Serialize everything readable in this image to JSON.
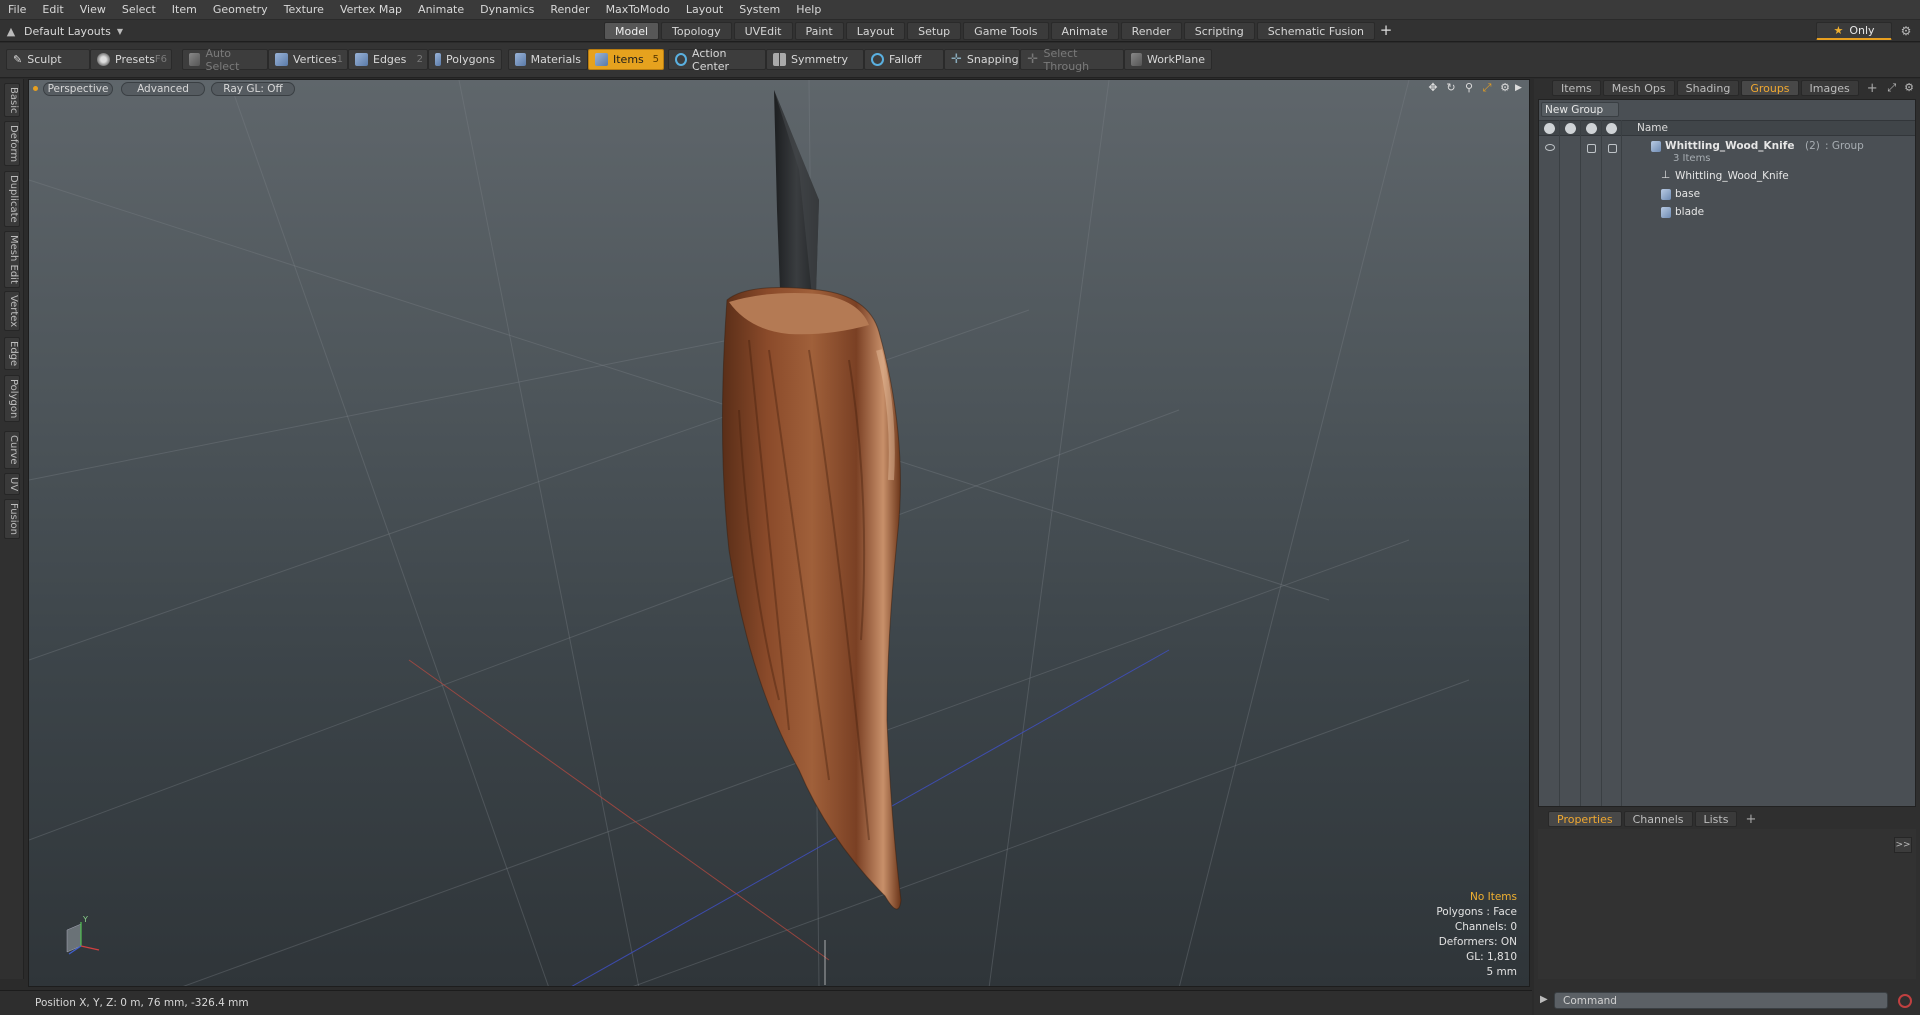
{
  "menu": [
    "File",
    "Edit",
    "View",
    "Select",
    "Item",
    "Geometry",
    "Texture",
    "Vertex Map",
    "Animate",
    "Dynamics",
    "Render",
    "MaxToModo",
    "Layout",
    "System",
    "Help"
  ],
  "layout": {
    "dropdown_label": "Default Layouts",
    "tabs": [
      "Model",
      "Topology",
      "UVEdit",
      "Paint",
      "Layout",
      "Setup",
      "Game Tools",
      "Animate",
      "Render",
      "Scripting",
      "Schematic Fusion"
    ],
    "active_tab": "Model",
    "add_tab": "+",
    "only_label": "Only"
  },
  "toolbar": {
    "sculpt": "Sculpt",
    "presets": "Presets",
    "presets_key": "F6",
    "auto_select": "Auto Select",
    "vertices": "Vertices",
    "vertices_key": "1",
    "edges": "Edges",
    "edges_key": "2",
    "polygons": "Polygons",
    "materials": "Materials",
    "items": "Items",
    "items_key": "5",
    "action_center": "Action Center",
    "symmetry": "Symmetry",
    "falloff": "Falloff",
    "snapping": "Snapping",
    "select_through": "Select Through",
    "workplane": "WorkPlane"
  },
  "left_tabs": [
    "Basic",
    "Deform",
    "Duplicate",
    "Mesh Edit",
    "Vertex",
    "Edge",
    "Polygon",
    "Curve",
    "UV",
    "Fusion"
  ],
  "viewport": {
    "view_mode": "Perspective",
    "shading": "Advanced",
    "raygl": "Ray GL: Off",
    "info": {
      "no_items": "No Items",
      "polygons": "Polygons : Face",
      "channels": "Channels: 0",
      "deformers": "Deformers: ON",
      "gl": "GL: 1,810",
      "scale": "5 mm"
    },
    "gizmo_y": "Y"
  },
  "status": {
    "position": "Position X, Y, Z:  0 m, 76 mm, -326.4 mm"
  },
  "right_panel": {
    "tabs": [
      "Items",
      "Mesh Ops",
      "Shading",
      "Groups",
      "Images"
    ],
    "active_tab": "Groups",
    "add_tab": "+",
    "new_group": "New Group",
    "name_column": "Name",
    "tree": {
      "group_name": "Whittling_Wood_Knife",
      "group_count": "(2)",
      "group_type": ": Group",
      "group_items": "3 Items",
      "children": [
        "Whittling_Wood_Knife",
        "base",
        "blade"
      ]
    },
    "bottom_tabs": [
      "Properties",
      "Channels",
      "Lists"
    ],
    "bottom_active": "Properties",
    "expand": ">>",
    "command_placeholder": "Command"
  },
  "colors": {
    "accent": "#e6a21e",
    "viewport_top": "#5f666b",
    "viewport_bottom": "#2f3539",
    "wood": "#8a4a2a"
  }
}
